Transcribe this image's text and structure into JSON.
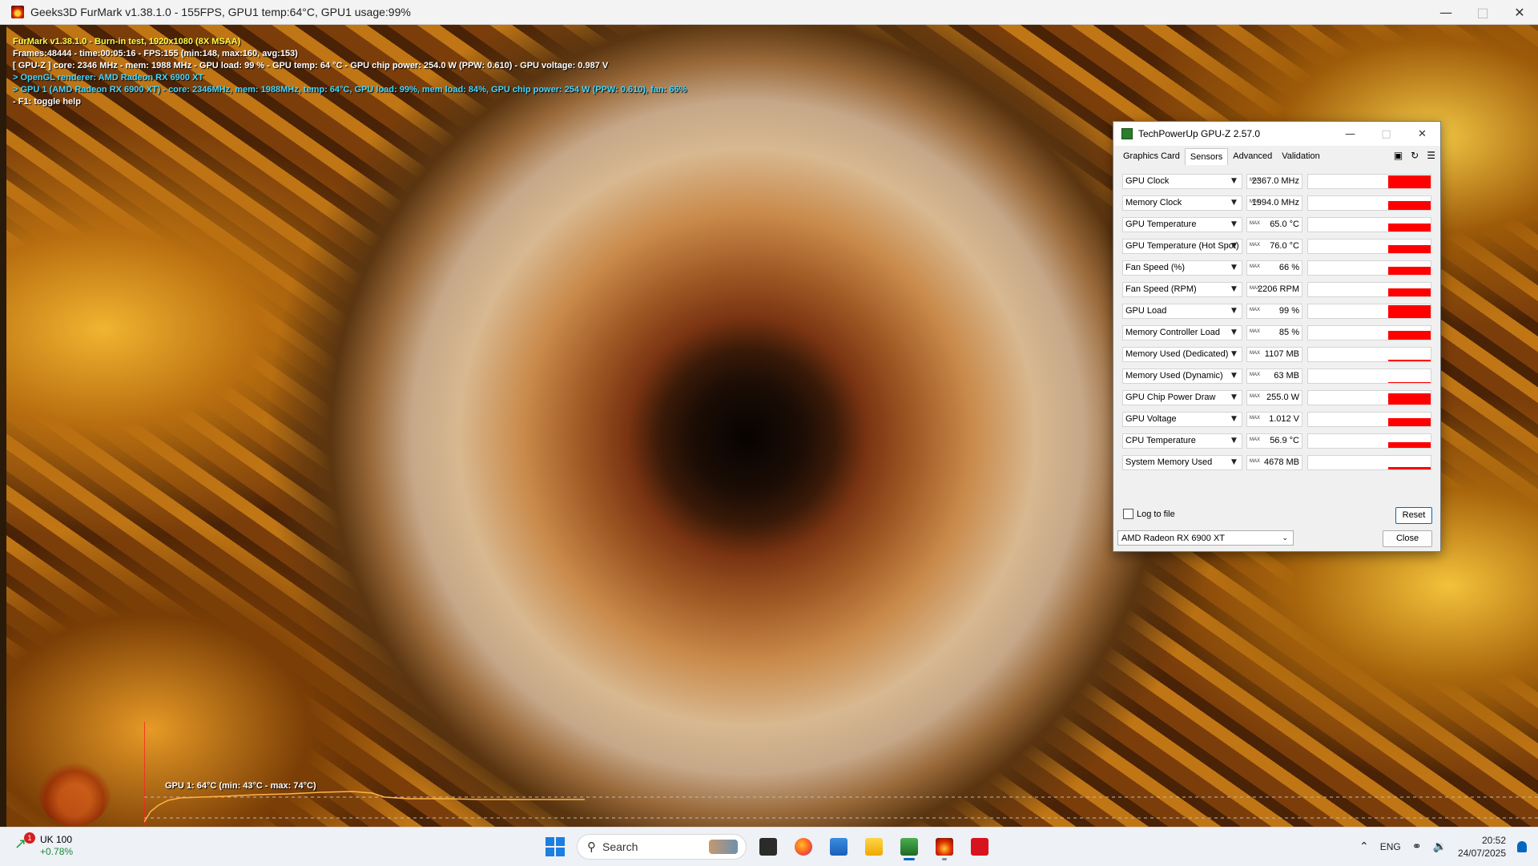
{
  "furmark": {
    "title": "Geeks3D FurMark v1.38.1.0 - 155FPS, GPU1 temp:64°C, GPU1 usage:99%",
    "osd": [
      {
        "text": "FurMark v1.38.1.0 - Burn-in test, 1920x1080 (8X MSAA)",
        "color": "yellow"
      },
      {
        "text": "Frames:48444 - time:00:05:16 - FPS:155 (min:148, max:160, avg:153)",
        "color": "white"
      },
      {
        "text": "[ GPU-Z ] core: 2346 MHz - mem: 1988 MHz - GPU load: 99 % - GPU temp: 64 °C - GPU chip power: 254.0 W (PPW: 0.610) - GPU voltage: 0.987 V",
        "color": "white"
      },
      {
        "text": "> OpenGL renderer: AMD Radeon RX 6900 XT",
        "color": "cyan"
      },
      {
        "text": "> GPU 1 (AMD Radeon RX 6900 XT) - core: 2346MHz, mem: 1988MHz, temp: 64°C, GPU load: 99%, mem load: 84%, GPU chip power: 254 W (PPW: 0.610), fan: 66%",
        "color": "cyan"
      },
      {
        "text": "- F1: toggle help",
        "color": "white"
      }
    ],
    "temp_graph_label": "GPU 1: 64°C (min: 43°C - max: 74°C)"
  },
  "gpuz": {
    "title": "TechPowerUp GPU-Z 2.57.0",
    "tabs": [
      "Graphics Card",
      "Sensors",
      "Advanced",
      "Validation"
    ],
    "active_tab": "Sensors",
    "sensors": [
      {
        "name": "GPU Clock",
        "value": "2367.0 MHz",
        "level": 0.85
      },
      {
        "name": "Memory Clock",
        "value": "1994.0 MHz",
        "level": 0.6
      },
      {
        "name": "GPU Temperature",
        "value": "65.0 °C",
        "level": 0.5
      },
      {
        "name": "GPU Temperature (Hot Spot)",
        "value": "76.0 °C",
        "level": 0.55
      },
      {
        "name": "Fan Speed (%)",
        "value": "66 %",
        "level": 0.5
      },
      {
        "name": "Fan Speed (RPM)",
        "value": "2206 RPM",
        "level": 0.55
      },
      {
        "name": "GPU Load",
        "value": "99 %",
        "level": 0.85
      },
      {
        "name": "Memory Controller Load",
        "value": "85 %",
        "level": 0.6
      },
      {
        "name": "Memory Used (Dedicated)",
        "value": "1107 MB",
        "level": 0.08
      },
      {
        "name": "Memory Used (Dynamic)",
        "value": "63 MB",
        "level": 0.0
      },
      {
        "name": "GPU Chip Power Draw",
        "value": "255.0 W",
        "level": 0.75
      },
      {
        "name": "GPU Voltage",
        "value": "1.012 V",
        "level": 0.5
      },
      {
        "name": "CPU Temperature",
        "value": "56.9 °C",
        "level": 0.35
      },
      {
        "name": "System Memory Used",
        "value": "4678 MB",
        "level": 0.15
      }
    ],
    "max_tag": "MAX",
    "log_label": "Log to file",
    "reset_label": "Reset",
    "close_label": "Close",
    "gpu_selected": "AMD Radeon RX 6900 XT",
    "fill_color": "#ff0000"
  },
  "taskbar": {
    "widget_title": "UK 100",
    "widget_change": "+0.78%",
    "widget_badge": "1",
    "search_placeholder": "Search",
    "apps": [
      "start",
      "search",
      "file-explorer-dark",
      "firefox",
      "microsoft-store",
      "file-explorer",
      "gpu-z",
      "furmark",
      "amd-software"
    ],
    "language": "ENG",
    "time": "20:52",
    "date": "24/07/2025"
  }
}
